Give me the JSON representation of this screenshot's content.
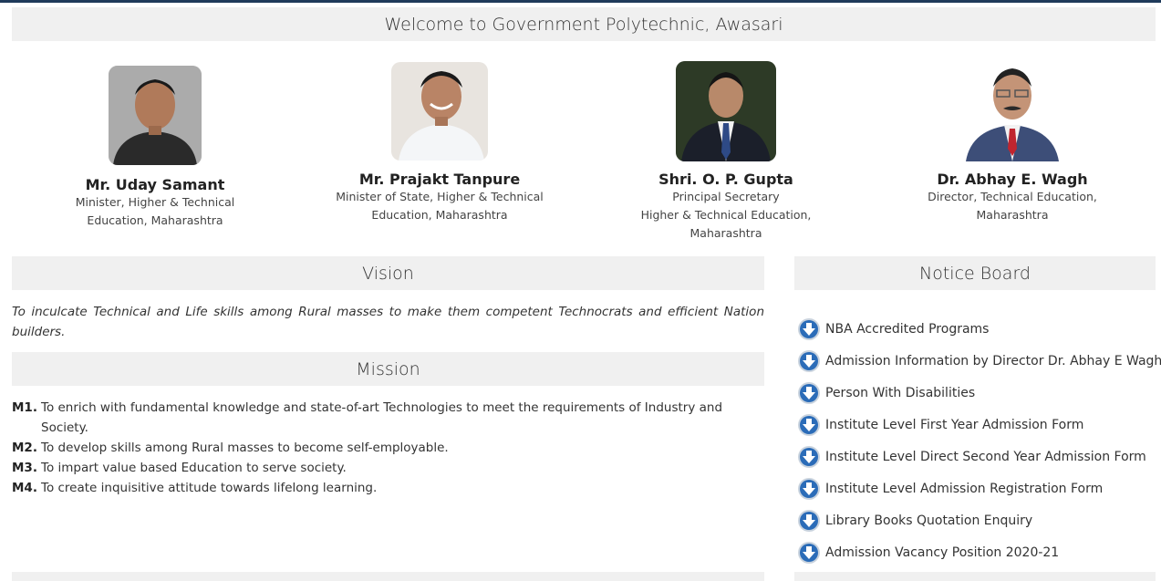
{
  "header": {
    "welcome": "Welcome to Government Polytechnic, Awasari"
  },
  "people": [
    {
      "name": "Mr. Uday Samant",
      "role": "Minister, Higher & Technical\nEducation, Maharashtra"
    },
    {
      "name": "Mr. Prajakt Tanpure",
      "role": "Minister of State, Higher & Technical\nEducation, Maharashtra"
    },
    {
      "name": "Shri. O. P. Gupta",
      "role": "Principal Secretary\nHigher & Technical Education,\nMaharashtra"
    },
    {
      "name": "Dr. Abhay E. Wagh",
      "role": "Director, Technical Education,\nMaharashtra"
    }
  ],
  "vision": {
    "title": "Vision",
    "text": "To inculcate Technical and Life skills among Rural masses to make them competent Technocrats and efficient Nation builders."
  },
  "mission": {
    "title": "Mission",
    "items": [
      {
        "num": "M1.",
        "text": "To enrich with fundamental knowledge and state-of-art Technologies to meet the requirements of Industry and Society."
      },
      {
        "num": "M2.",
        "text": "To develop skills among Rural masses to become self-employable."
      },
      {
        "num": "M3.",
        "text": "To impart value based Education to serve society."
      },
      {
        "num": "M4.",
        "text": "To create inquisitive attitude towards lifelong learning."
      }
    ]
  },
  "notice_board": {
    "title": "Notice Board",
    "icon": "download-arrow-icon",
    "items": [
      "NBA Accredited Programs",
      "Admission Information by Director Dr. Abhay E Wagh",
      "Person With Disabilities",
      "Institute Level First Year Admission Form",
      "Institute Level Direct Second Year Admission Form",
      "Institute Level Admission Registration Form",
      "Library Books Quotation Enquiry",
      "Admission Vacancy Position 2020-21"
    ]
  },
  "colors": {
    "bar": "#f0f0f0",
    "icon_blue": "#2b6cb8",
    "topline": "#1f3a5a"
  }
}
